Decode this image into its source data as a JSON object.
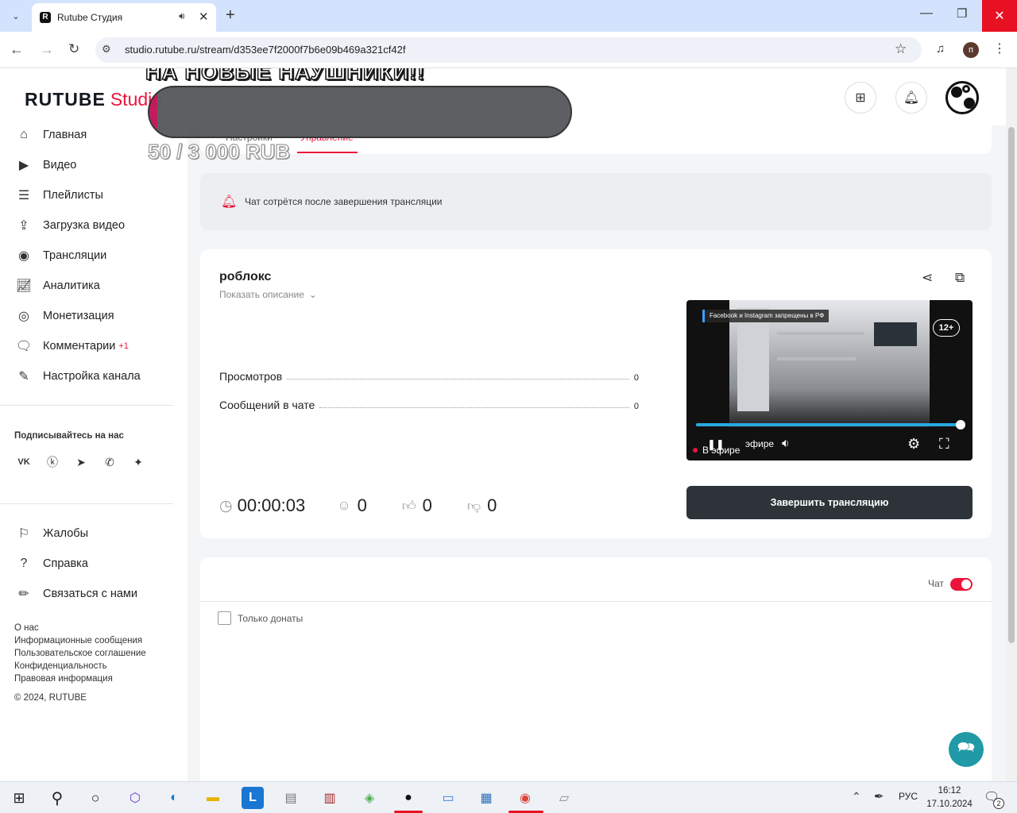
{
  "browser": {
    "tab_title": "Rutube Студия",
    "url": "studio.rutube.ru/stream/d353ee7f2000f7b6e09b469a321cf42f",
    "profile_initial": "п"
  },
  "header": {
    "logo_main": "RUTUBE",
    "logo_studio": "Studio"
  },
  "overlay": {
    "donation_goal_text": "НА НОВЫЕ НАУШНИКИ!!",
    "donation_progress_text": "50 / 3 000 RUB",
    "donation_progress_fraction": 0.017
  },
  "sidebar": {
    "items": [
      {
        "label": "Главная",
        "icon": "home-icon"
      },
      {
        "label": "Видео",
        "icon": "video-icon"
      },
      {
        "label": "Плейлисты",
        "icon": "playlist-icon"
      },
      {
        "label": "Загрузка видео",
        "icon": "upload-icon"
      },
      {
        "label": "Трансляции",
        "icon": "broadcast-icon"
      },
      {
        "label": "Аналитика",
        "icon": "analytics-icon"
      },
      {
        "label": "Монетизация",
        "icon": "coin-icon"
      },
      {
        "label": "Комментарии",
        "icon": "comments-icon",
        "badge": "+1"
      },
      {
        "label": "Настройка канала",
        "icon": "magic-wand-icon"
      }
    ],
    "subscribe_title": "Подписывайтесь на нас",
    "socials": [
      "vk-icon",
      "ok-icon",
      "telegram-icon",
      "viber-icon",
      "dzen-icon"
    ],
    "bottom_items": [
      {
        "label": "Жалобы",
        "icon": "flag-icon"
      },
      {
        "label": "Справка",
        "icon": "question-icon"
      },
      {
        "label": "Связаться с нами",
        "icon": "pencil-icon"
      }
    ],
    "footer_links": [
      "О нас",
      "Информационные сообщения",
      "Пользовательское соглашение",
      "Конфиденциальность",
      "Правовая информация"
    ],
    "copyright": "© 2024, RUTUBE"
  },
  "tabs": {
    "settings": "Настройки",
    "manage": "Управление"
  },
  "notice": {
    "text": "Чат сотрётся после завершения трансляции"
  },
  "stream": {
    "title": "роблокс",
    "show_description": "Показать описание",
    "views_label": "Просмотров",
    "views_value": "0",
    "chat_messages_label": "Сообщений в чате",
    "chat_messages_value": "0",
    "timer": "00:00:03",
    "viewers": "0",
    "likes": "0",
    "dislikes": "0",
    "end_button": "Завершить трансляцию"
  },
  "player": {
    "age_rating": "12+",
    "live_label": "В эфире",
    "live_label_partial": "эфире",
    "banner_text": "Facebook и Instagram запрещены в РФ",
    "progress_fraction": 0.99
  },
  "chat": {
    "toggle_label": "Чат",
    "toggle_on": true,
    "donations_only_label": "Только донаты"
  },
  "taskbar": {
    "lang": "РУС",
    "time": "16:12",
    "date": "17.10.2024",
    "notifications": "2"
  }
}
